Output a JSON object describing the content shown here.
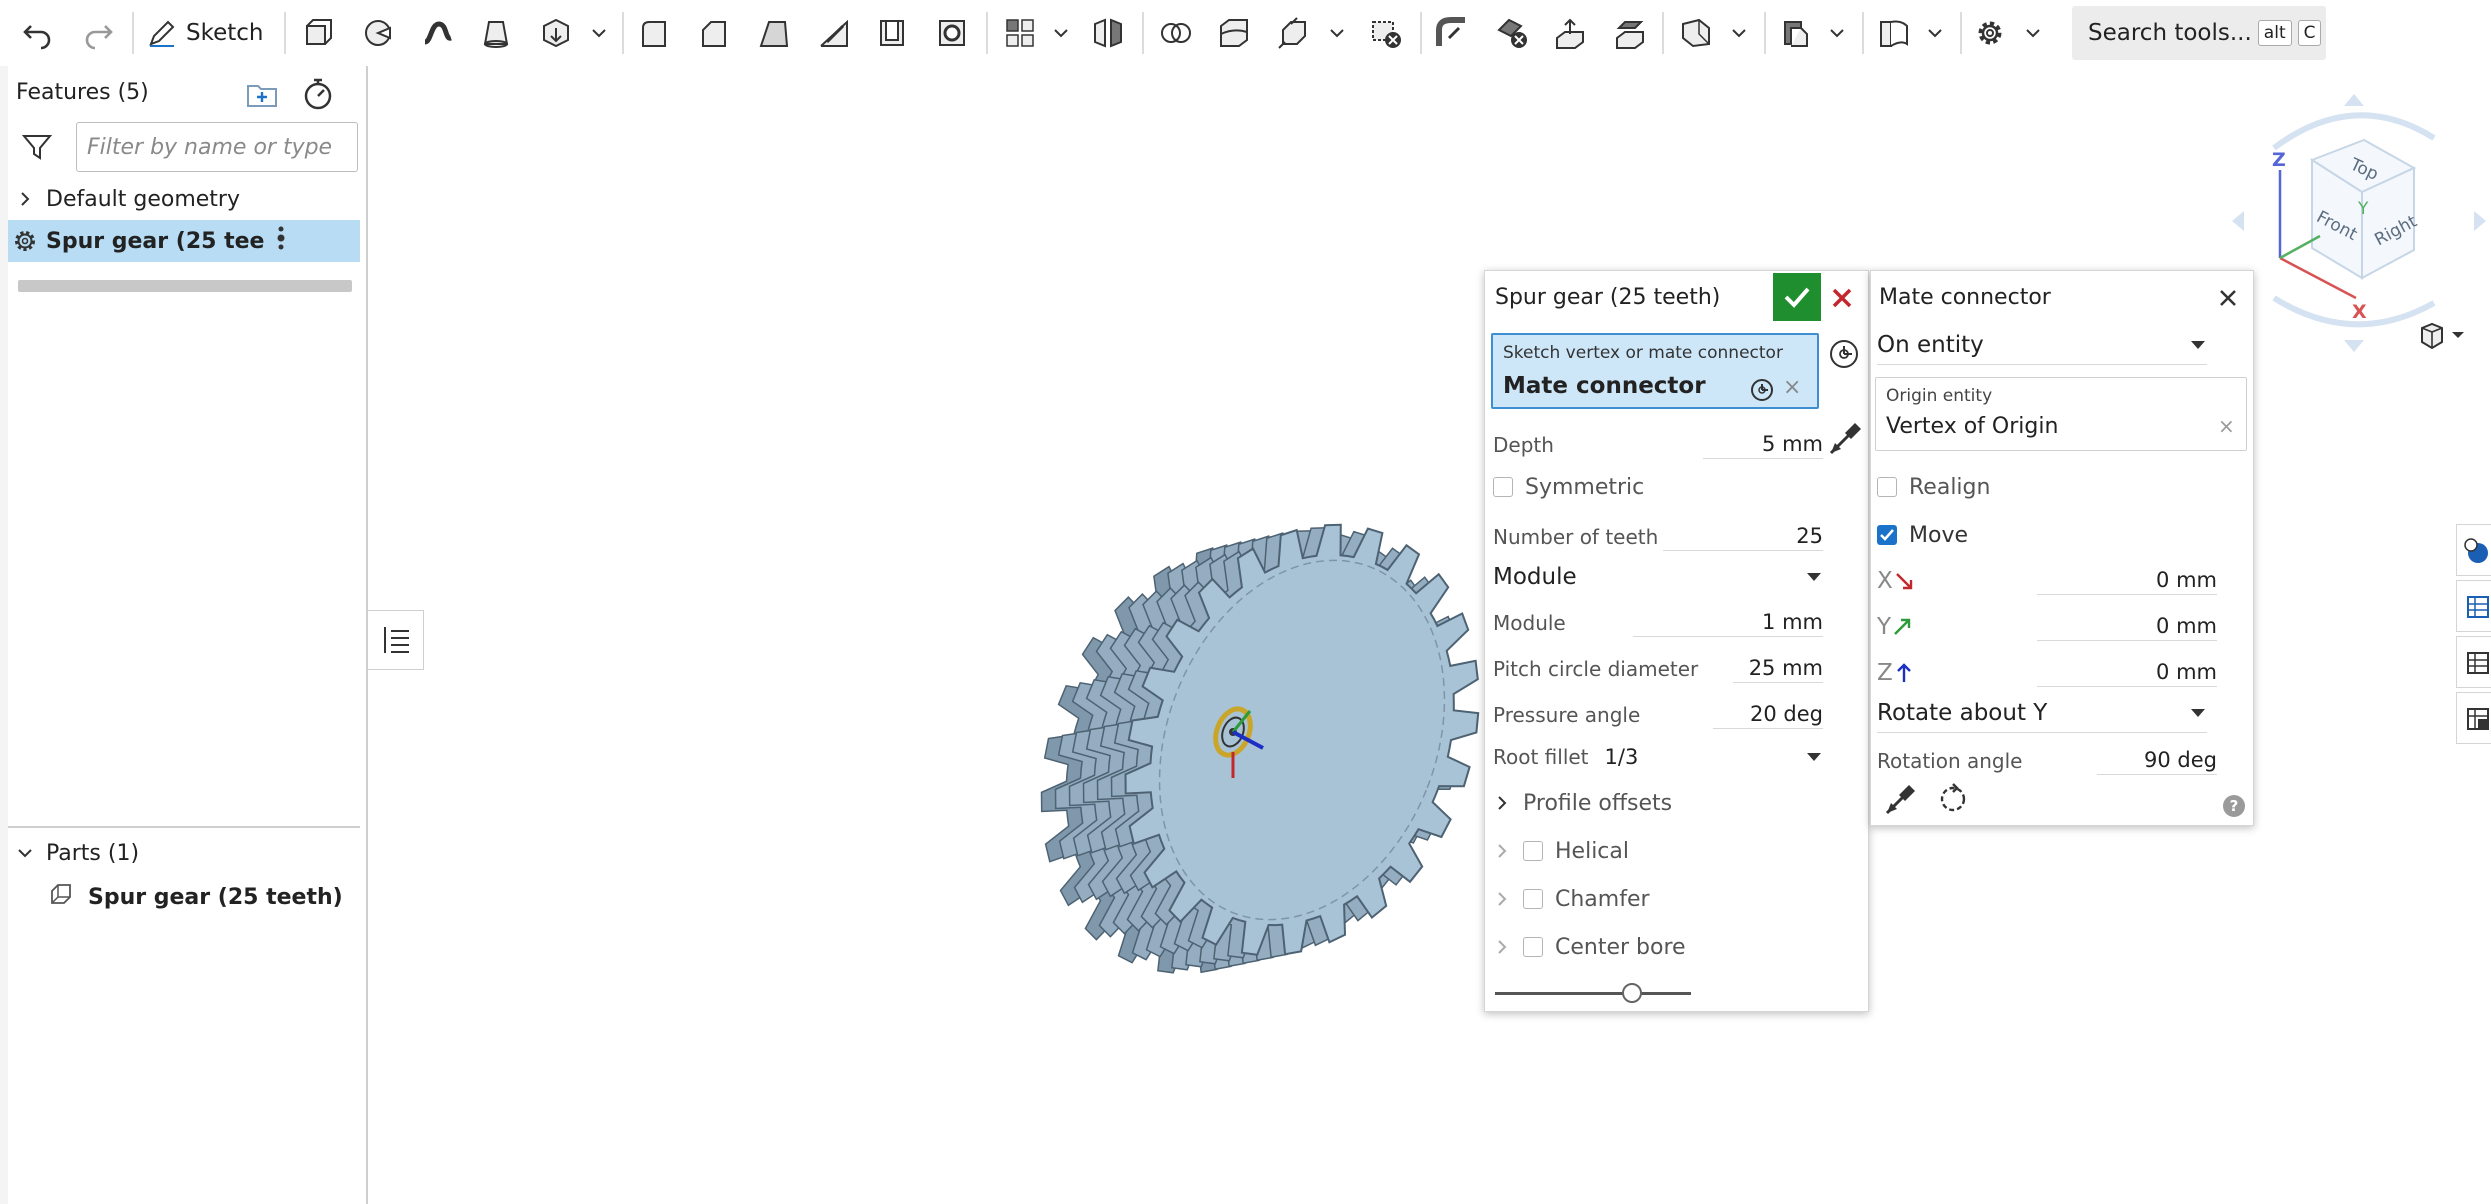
{
  "toolbar": {
    "sketch_label": "Sketch",
    "search_label": "Search tools...",
    "search_key_1": "alt",
    "search_key_2": "C"
  },
  "feature_panel": {
    "title": "Features (5)",
    "filter_placeholder": "Filter by name or type",
    "items": [
      {
        "label": "Default geometry"
      },
      {
        "label": "Spur gear (25 tee..."
      }
    ],
    "parts_header": "Parts (1)",
    "parts": [
      {
        "label": "Spur gear (25 teeth)"
      }
    ]
  },
  "spur_dialog": {
    "title": "Spur gear (25 teeth)",
    "selection_label": "Sketch vertex or mate connector",
    "selection_value": "Mate connector",
    "depth_label": "Depth",
    "depth_value": "5 mm",
    "symmetric_label": "Symmetric",
    "teeth_label": "Number of teeth",
    "teeth_value": "25",
    "mode_value": "Module",
    "module_label": "Module",
    "module_value": "1 mm",
    "pitch_label": "Pitch circle diameter",
    "pitch_value": "25 mm",
    "pressure_label": "Pressure angle",
    "pressure_value": "20 deg",
    "root_fillet_label": "Root fillet",
    "root_fillet_value": "1/3",
    "profile_offsets_label": "Profile offsets",
    "helical_label": "Helical",
    "chamfer_label": "Chamfer",
    "center_bore_label": "Center bore",
    "slider_value": 0.7
  },
  "mc_dialog": {
    "title": "Mate connector",
    "type_value": "On entity",
    "origin_label": "Origin entity",
    "origin_value": "Vertex of Origin",
    "realign_label": "Realign",
    "move_label": "Move",
    "x_label": "X",
    "x_value": "0 mm",
    "y_label": "Y",
    "y_value": "0 mm",
    "z_label": "Z",
    "z_value": "0 mm",
    "rotate_value": "Rotate about Y",
    "rotation_label": "Rotation angle",
    "rotation_value": "90 deg",
    "help_label": "?"
  },
  "view_cube": {
    "top": "Top",
    "front": "Front",
    "right": "Right",
    "axis_x": "X",
    "axis_y": "Y",
    "axis_z": "Z"
  },
  "colors": {
    "accent": "#1a73c8",
    "selected_row": "#b7dcf4",
    "ok_green": "#1e8e2f",
    "cancel_red": "#c4262e",
    "gear_fill": "#a9c3d6",
    "x_axis": "#c4262e",
    "y_axis": "#2e9b3a",
    "z_axis": "#1c2fc4"
  }
}
